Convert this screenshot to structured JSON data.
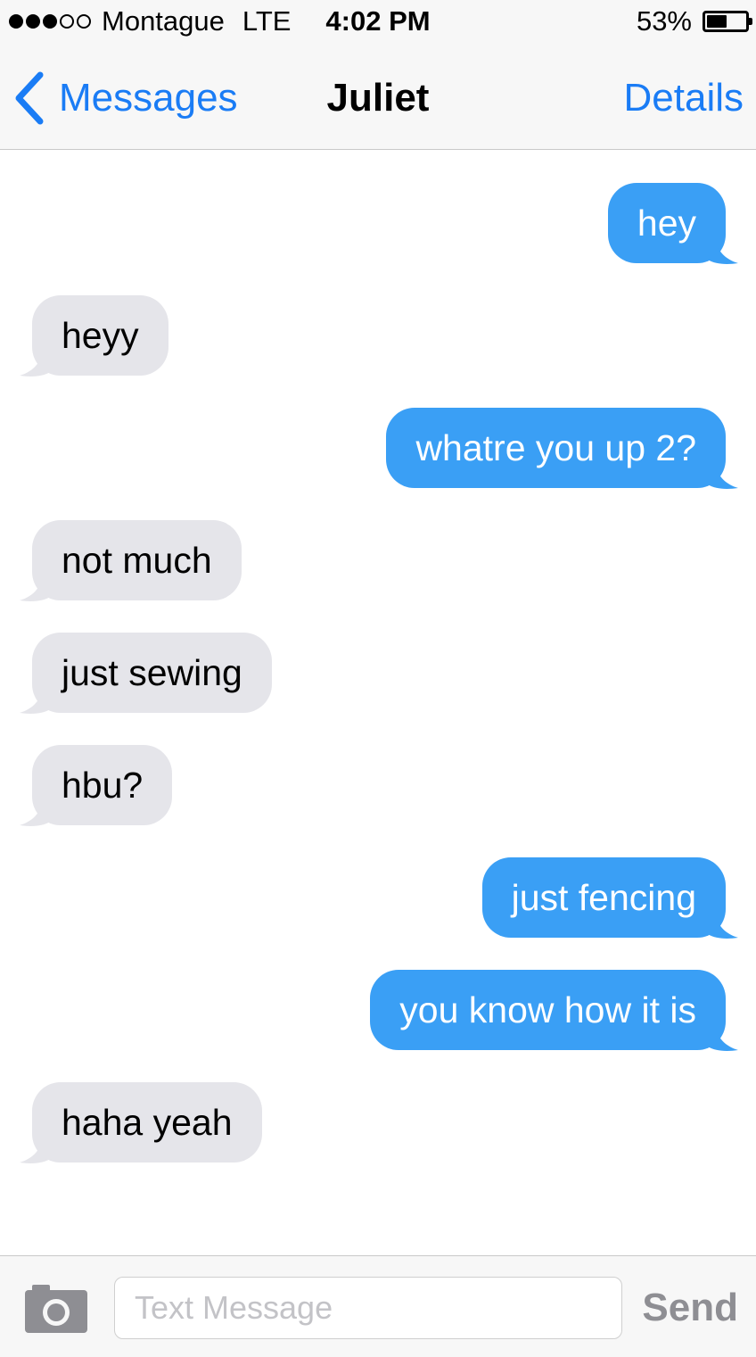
{
  "status_bar": {
    "signal": [
      true,
      true,
      true,
      false,
      false
    ],
    "carrier": "Montague",
    "network": "LTE",
    "time": "4:02 PM",
    "battery_label": "53%",
    "battery_level": 0.53
  },
  "nav": {
    "back_label": "Messages",
    "title": "Juliet",
    "details_label": "Details"
  },
  "messages": [
    {
      "direction": "sent",
      "text": "hey"
    },
    {
      "direction": "received",
      "text": "heyy"
    },
    {
      "direction": "sent",
      "text": "whatre you up 2?"
    },
    {
      "direction": "received",
      "text": "not much"
    },
    {
      "direction": "received",
      "text": "just sewing"
    },
    {
      "direction": "received",
      "text": "hbu?"
    },
    {
      "direction": "sent",
      "text": "just fencing"
    },
    {
      "direction": "sent",
      "text": "you know how it is"
    },
    {
      "direction": "received",
      "text": "haha yeah"
    }
  ],
  "input_bar": {
    "placeholder": "Text Message",
    "value": "",
    "send_label": "Send"
  },
  "colors": {
    "accent": "#1a7cf5",
    "sent_bubble": "#3a9ff5",
    "received_bubble": "#e5e5ea",
    "send_disabled": "#8e8e93"
  }
}
